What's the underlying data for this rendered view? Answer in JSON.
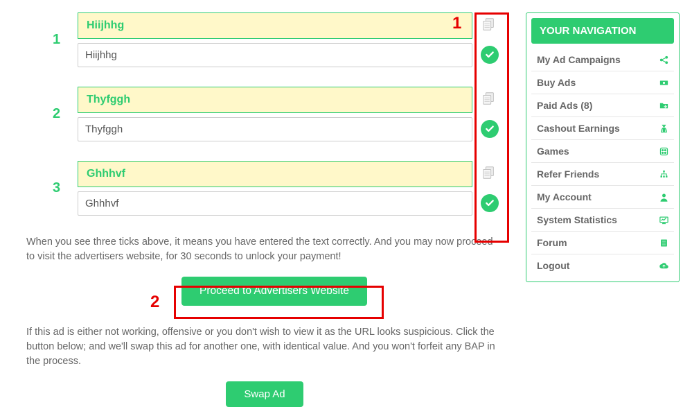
{
  "entries": [
    {
      "num": "1",
      "header": "Hiijhhg",
      "value": "Hiijhhg"
    },
    {
      "num": "2",
      "header": "Thyfggh",
      "value": "Thyfggh"
    },
    {
      "num": "3",
      "header": "Ghhhvf",
      "value": "Ghhhvf"
    }
  ],
  "instructions": {
    "proceed_info": "When you see three ticks above, it means you have entered the text correctly. And you may now proceed to visit the advertisers website, for 30 seconds to unlock your payment!",
    "swap_info": "If this ad is either not working, offensive or you don't wish to view it as the URL looks suspicious. Click the button below; and we'll swap this ad for another one, with identical value. And you won't forfeit any BAP in the process."
  },
  "buttons": {
    "proceed": "Proceed to Advertisers Website",
    "swap": "Swap Ad"
  },
  "annotations": {
    "one": "1",
    "two": "2"
  },
  "sidebar": {
    "title": "YOUR NAVIGATION",
    "items": [
      {
        "label": "My Ad Campaigns"
      },
      {
        "label": "Buy Ads"
      },
      {
        "label": "Paid Ads (8)"
      },
      {
        "label": "Cashout Earnings"
      },
      {
        "label": "Games"
      },
      {
        "label": "Refer Friends"
      },
      {
        "label": "My Account"
      },
      {
        "label": "System Statistics"
      },
      {
        "label": "Forum"
      },
      {
        "label": "Logout"
      }
    ]
  }
}
